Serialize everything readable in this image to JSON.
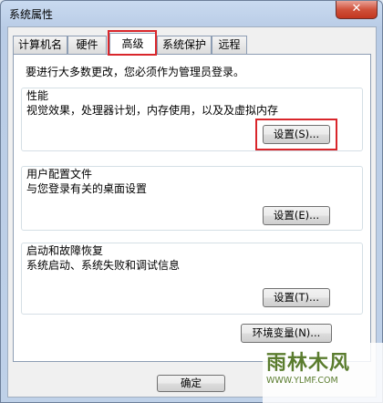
{
  "window": {
    "title": "系统属性",
    "close_label": "✕"
  },
  "tabs": [
    {
      "label": "计算机名"
    },
    {
      "label": "硬件"
    },
    {
      "label": "高级",
      "active": true
    },
    {
      "label": "系统保护"
    },
    {
      "label": "远程"
    }
  ],
  "advanced": {
    "admin_notice": "要进行大多数更改，您必须作为管理员登录。",
    "performance": {
      "title": "性能",
      "description": "视觉效果，处理器计划，内存使用，以及及虚拟内存",
      "button": "设置(S)..."
    },
    "user_profiles": {
      "title": "用户配置文件",
      "description": "与您登录有关的桌面设置",
      "button": "设置(E)..."
    },
    "startup_recovery": {
      "title": "启动和故障恢复",
      "description": "系统启动、系统失败和调试信息",
      "button": "设置(T)..."
    },
    "env_button": "环境变量(N)..."
  },
  "footer": {
    "ok_button": "确定"
  },
  "watermark": {
    "logo": "雨林木风",
    "url": "WWW.YLMF.COM"
  }
}
